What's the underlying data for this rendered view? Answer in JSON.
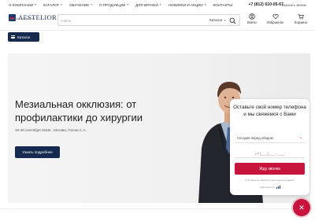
{
  "topnav": {
    "items": [
      {
        "label": "О КОМПАНИИ"
      },
      {
        "label": "КАТАЛОГ"
      },
      {
        "label": "ОБУЧЕНИЕ"
      },
      {
        "label": "О ПРОДУКЦИИ"
      },
      {
        "label": "ДЛЯ ВРАЧЕЙ"
      },
      {
        "label": "НОВИНКИ И АКЦИИ"
      },
      {
        "label": "КОНТАКТЫ"
      }
    ],
    "phone": "+7 (812) 610-05-67",
    "callback": "Заказать звонок"
  },
  "header": {
    "logo_text": "AESTELIOR",
    "logo_sub": "для ваших пациентов",
    "search_placeholder": "Найти",
    "search_category": "Каталог",
    "icons": [
      {
        "name": "login",
        "label": "Войти",
        "icon": "user-icon"
      },
      {
        "name": "favorites",
        "label": "Избранное",
        "icon": "heart-icon"
      },
      {
        "name": "cart",
        "label": "Корзина",
        "icon": "cart-icon"
      }
    ]
  },
  "catalog_button": {
    "label": "Каталог"
  },
  "banner": {
    "title": "Мезиальная окклюзия: от профилактики до хирургии",
    "meta": "19-20 сентября 2026г., Москва, Попов С.А.",
    "button": "Узнать подробнее"
  },
  "form": {
    "title": "Оставьте свой номер телефона и мы свяжемся с Вами",
    "select_value": "Сегодня перед обедом",
    "phone_placeholder": "+7 (___) ___-____",
    "submit": "Жду звонка",
    "agree": "Я согласен на обработку персональных данных",
    "brand": "callbackhunter"
  },
  "colors": {
    "accent": "#c8143c",
    "primary": "#152a4e"
  }
}
